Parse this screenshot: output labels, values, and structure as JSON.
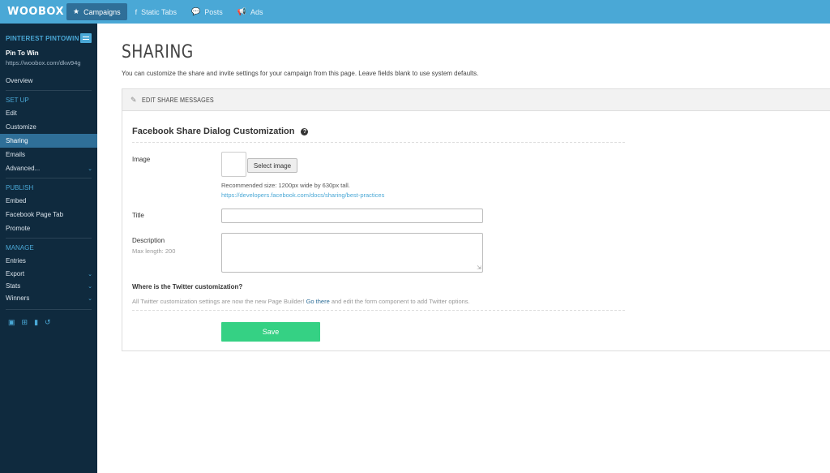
{
  "brand": {
    "logo": "WOOBOX"
  },
  "topnav": {
    "items": [
      {
        "label": "Campaigns",
        "icon": "star-icon",
        "glyph": "★",
        "active": true
      },
      {
        "label": "Static Tabs",
        "icon": "facebook-icon",
        "glyph": "f",
        "active": false
      },
      {
        "label": "Posts",
        "icon": "comment-icon",
        "glyph": "💬",
        "active": false
      },
      {
        "label": "Ads",
        "icon": "megaphone-icon",
        "glyph": "📢",
        "active": false
      }
    ]
  },
  "sidebar": {
    "campaign_type": "PINTEREST PINTOWIN",
    "campaign_name": "Pin To Win",
    "campaign_url": "https://woobox.com/dkw94g",
    "overview": "Overview",
    "setup_title": "SET UP",
    "setup_items": [
      "Edit",
      "Customize",
      "Sharing",
      "Emails",
      "Advanced..."
    ],
    "publish_title": "PUBLISH",
    "publish_items": [
      "Embed",
      "Facebook Page Tab",
      "Promote"
    ],
    "manage_title": "MANAGE",
    "manage_items": [
      "Entries",
      "Export",
      "Stats",
      "Winners"
    ]
  },
  "main": {
    "title": "SHARING",
    "description": "You can customize the share and invite settings for your campaign from this page. Leave fields blank to use system defaults.",
    "panel_header": "EDIT SHARE MESSAGES",
    "section_title": "Facebook Share Dialog Customization",
    "image_label": "Image",
    "select_image_button": "Select image",
    "image_hint": "Recommended size: 1200px wide by 630px tall.",
    "image_link": "https://developers.facebook.com/docs/sharing/best-practices",
    "title_label": "Title",
    "title_value": "",
    "description_label": "Description",
    "description_sublabel": "Max length: 200",
    "description_value": "",
    "twitter_heading": "Where is the Twitter customization?",
    "twitter_text_before": "All Twitter customization settings are now the new Page Builder! ",
    "twitter_link": "Go there",
    "twitter_text_after": " and edit the form component to add Twitter options.",
    "save_button": "Save"
  },
  "colors": {
    "topbar": "#4aa8d6",
    "sidebar": "#0f2a3e",
    "active": "#2f6f98",
    "save": "#35d184"
  }
}
